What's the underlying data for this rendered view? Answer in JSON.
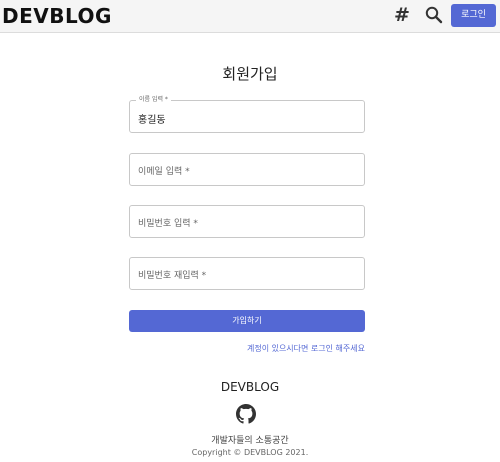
{
  "header": {
    "brand": "DEVBLOG",
    "hash_icon": "hash-icon",
    "search_icon": "search-icon",
    "login_label": "로그인"
  },
  "form": {
    "title": "회원가입",
    "name": {
      "label": "이름 입력 *",
      "value": "홍길동"
    },
    "email": {
      "placeholder": "이메일 입력 *"
    },
    "password": {
      "placeholder": "비밀번호 입력 *"
    },
    "password_confirm": {
      "placeholder": "비밀번호 재입력 *"
    },
    "submit_label": "가입하기",
    "login_link": "계정이 있으시다면 로그인 해주세요"
  },
  "footer": {
    "brand": "DEVBLOG",
    "github_icon": "github-icon",
    "tagline": "개발자들의 소통공간",
    "copyright": "Copyright © DEVBLOG 2021."
  },
  "colors": {
    "accent": "#5468d4",
    "header_bg": "#f5f5f5"
  }
}
